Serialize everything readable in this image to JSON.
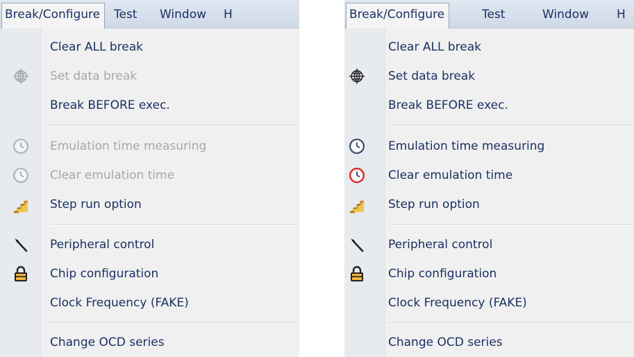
{
  "menubar": [
    "Break/Configure",
    "Test",
    "Window",
    "H"
  ],
  "panels": [
    {
      "variant": "disabled-state",
      "items": [
        {
          "label": "Clear ALL break",
          "enabled": true,
          "icon": null
        },
        {
          "label": "Set data break",
          "enabled": false,
          "icon": "crosshair-globe-icon"
        },
        {
          "label": "Break BEFORE exec.",
          "enabled": true,
          "icon": null
        },
        {
          "label": "Emulation time measuring",
          "enabled": false,
          "icon": "clock-icon"
        },
        {
          "label": "Clear emulation time",
          "enabled": false,
          "icon": "clock-icon"
        },
        {
          "label": "Step run option",
          "enabled": true,
          "icon": "steps-icon"
        },
        {
          "label": "Peripheral control",
          "enabled": true,
          "icon": "hammer-icon"
        },
        {
          "label": "Chip configuration",
          "enabled": true,
          "icon": "padlock-icon"
        },
        {
          "label": "Clock Frequency (FAKE)",
          "enabled": true,
          "icon": null
        },
        {
          "label": "Change OCD series",
          "enabled": true,
          "icon": null
        }
      ]
    },
    {
      "variant": "enabled-state",
      "items": [
        {
          "label": "Clear ALL break",
          "enabled": true,
          "icon": null
        },
        {
          "label": "Set data break",
          "enabled": true,
          "icon": "crosshair-globe-icon"
        },
        {
          "label": "Break BEFORE exec.",
          "enabled": true,
          "icon": null
        },
        {
          "label": "Emulation time measuring",
          "enabled": true,
          "icon": "clock-icon"
        },
        {
          "label": "Clear emulation time",
          "enabled": true,
          "icon": "clock-red-icon"
        },
        {
          "label": "Step run option",
          "enabled": true,
          "icon": "steps-icon"
        },
        {
          "label": "Peripheral control",
          "enabled": true,
          "icon": "hammer-icon"
        },
        {
          "label": "Chip configuration",
          "enabled": true,
          "icon": "padlock-icon"
        },
        {
          "label": "Clock Frequency (FAKE)",
          "enabled": true,
          "icon": null
        },
        {
          "label": "Change OCD series",
          "enabled": true,
          "icon": null
        }
      ]
    }
  ],
  "colors": {
    "menu_text": "#1a2f63",
    "disabled_text": "#a3a7ad",
    "menubar_bg": "#d6dfea",
    "menu_bg": "#f0f0f0",
    "gutter_bg": "#e7eaee",
    "clock_red": "#d02020",
    "steps_orange": "#e0a020"
  }
}
